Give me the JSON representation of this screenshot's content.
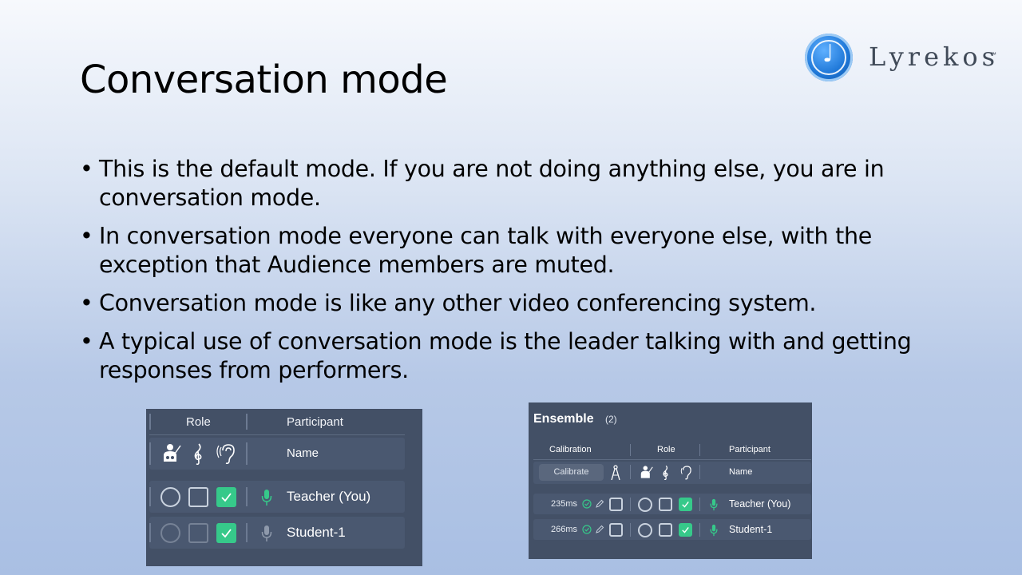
{
  "slide": {
    "title": "Conversation mode",
    "bullets": [
      "This is the default mode. If you are not doing anything else, you are in conversation mode.",
      "In conversation mode everyone can talk with everyone else, with the exception that Audience members are muted.",
      "Conversation mode is like any other video conferencing system.",
      "A typical use of conversation mode is the leader talking with and getting responses from performers."
    ]
  },
  "logo": {
    "text": "Lyrekos",
    "tm": "™"
  },
  "left_panel": {
    "header_role": "Role",
    "header_participant": "Participant",
    "subheader_name": "Name",
    "rows": [
      {
        "name": "Teacher (You)",
        "mic": "active"
      },
      {
        "name": "Student-1",
        "mic": "inactive"
      }
    ]
  },
  "right_panel": {
    "title": "Ensemble",
    "count": "(2)",
    "header_calibration": "Calibration",
    "header_role": "Role",
    "header_participant": "Participant",
    "calibrate_button": "Calibrate",
    "subheader_name": "Name",
    "rows": [
      {
        "latency": "235ms",
        "name": "Teacher (You)"
      },
      {
        "latency": "266ms",
        "name": "Student-1"
      }
    ]
  },
  "colors": {
    "panel_bg": "#435066",
    "check_green": "#36c98a",
    "mic_green": "#36c98a"
  }
}
